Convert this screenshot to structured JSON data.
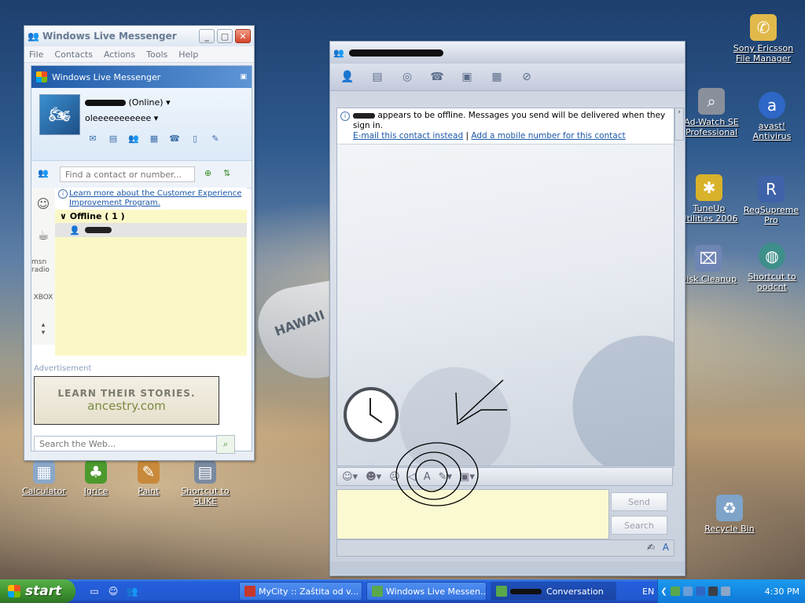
{
  "desktop_icons": [
    {
      "label": "Sony Ericsson File Manager",
      "icon": "phone-folder-icon",
      "color": "#e1b84a"
    },
    {
      "label": "Ad-Watch SE Professional",
      "icon": "magnifier-icon",
      "color": "#8a8f9c"
    },
    {
      "label": "avast! Antivirus",
      "icon": "avast-icon",
      "color": "#2f67c7"
    },
    {
      "label": "TuneUp Utilities 2006",
      "icon": "tuneup-icon",
      "color": "#d8b22a"
    },
    {
      "label": "RegSupreme Pro",
      "icon": "regsupreme-icon",
      "color": "#3f63a8"
    },
    {
      "label": "Disk Cleanup",
      "icon": "broom-icon",
      "color": "#6f86b5"
    },
    {
      "label": "Shortcut to oodcnt",
      "icon": "globe-icon",
      "color": "#3e8f8a"
    },
    {
      "label": "Recycle Bin",
      "icon": "recycle-bin-icon",
      "color": "#7ea4c9"
    },
    {
      "label": "Calculator",
      "icon": "calculator-icon",
      "color": "#8aa7c8"
    },
    {
      "label": "Igrice",
      "icon": "tree-icon",
      "color": "#4c9a2e"
    },
    {
      "label": "Paint",
      "icon": "paint-icon",
      "color": "#c88a3a"
    },
    {
      "label": "Shortcut to SLIKE",
      "icon": "folder-icon",
      "color": "#7a8aa0"
    }
  ],
  "messenger": {
    "window_title": "Windows Live Messenger",
    "menu": [
      "File",
      "Contacts",
      "Actions",
      "Tools",
      "Help"
    ],
    "header_title": "Windows Live Messenger",
    "status": "(Online)",
    "personal_message": "oleeeeeeeeeee",
    "search_placeholder": "Find a contact or number...",
    "info_link": "Learn more about the Customer Experience Improvement Program.",
    "group": "Offline ( 1 )",
    "sidebar_msn": "msn radio",
    "sidebar_xbox": "XBOX",
    "ad_label": "Advertisement",
    "ad_line1": "LEARN THEIR STORIES.",
    "ad_line2": "ancestry.com",
    "web_search_placeholder": "Search the Web..."
  },
  "conversation": {
    "offline_notice": "appears to be offline. Messages you send will be delivered when they sign in.",
    "link_email": "E-mail this contact instead",
    "link_sep": "|",
    "link_mobile": "Add a mobile number for this contact",
    "send_label": "Send",
    "search_label": "Search"
  },
  "taskbar": {
    "start_label": "start",
    "tasks": [
      {
        "label": "MyCity :: Zaštita od v...",
        "color": "#c8372c"
      },
      {
        "label": "Windows Live Messen...",
        "color": "#5aa84b"
      },
      {
        "label": "Conversation",
        "color": "#5aa84b"
      }
    ],
    "lang": "EN",
    "time": "4:30 PM"
  }
}
